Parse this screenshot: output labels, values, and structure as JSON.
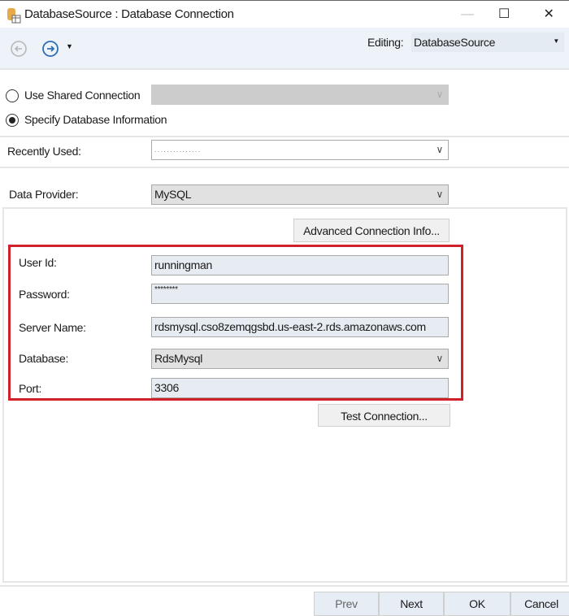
{
  "window": {
    "title": "DatabaseSource : Database Connection",
    "minimize": "—",
    "maximize": "☐",
    "close": "✕"
  },
  "toolbar": {
    "editing_label": "Editing:",
    "editing_value": "DatabaseSource"
  },
  "connection_mode": {
    "shared_label": "Use Shared Connection",
    "specify_label": "Specify Database Information",
    "selected": "specify"
  },
  "recently_used": {
    "label": "Recently Used:",
    "value": ". . . . . . . . . . . . . . ."
  },
  "data_provider": {
    "label": "Data Provider:",
    "value": "MySQL"
  },
  "advanced_button": "Advanced Connection Info...",
  "fields": {
    "user_id": {
      "label": "User Id:",
      "value": "runningman"
    },
    "password": {
      "label": "Password:",
      "value": "********"
    },
    "server_name": {
      "label": "Server Name:",
      "value": "rdsmysql.cso8zemqgsbd.us-east-2.rds.amazonaws.com"
    },
    "database": {
      "label": "Database:",
      "value": "RdsMysql"
    },
    "port": {
      "label": "Port:",
      "value": "3306"
    }
  },
  "test_button": "Test Connection...",
  "footer": {
    "prev": "Prev",
    "next": "Next",
    "ok": "OK",
    "cancel": "Cancel"
  },
  "colors": {
    "highlight": "#d0202a",
    "toolbar_bg": "#eef3f9",
    "nav_blue": "#2e6db4"
  }
}
